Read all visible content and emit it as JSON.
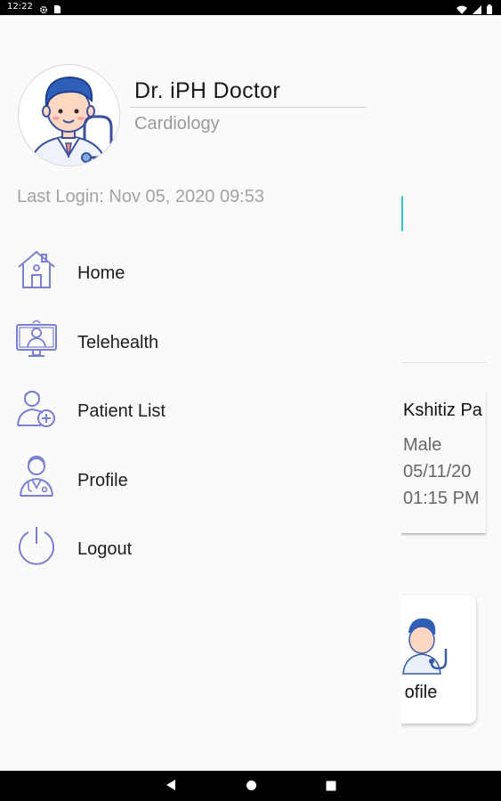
{
  "status_bar": {
    "time": "12:22",
    "left_icons": [
      "gear-icon",
      "sim-card-icon"
    ],
    "right_icons": [
      "wifi-icon",
      "signal-icon",
      "battery-icon"
    ]
  },
  "drawer": {
    "doctor_name": "Dr. iPH Doctor",
    "specialty": "Cardiology",
    "last_login": "Last Login: Nov 05, 2020 09:53",
    "menu": [
      {
        "label": "Home",
        "icon": "home-icon"
      },
      {
        "label": "Telehealth",
        "icon": "telehealth-icon"
      },
      {
        "label": "Patient List",
        "icon": "patient-list-icon"
      },
      {
        "label": "Profile",
        "icon": "doctor-profile-icon"
      },
      {
        "label": "Logout",
        "icon": "power-icon"
      }
    ]
  },
  "background": {
    "patient_name": "Kshitiz Pa",
    "patient_gender": "Male",
    "patient_date": "05/11/20",
    "patient_time": "01:15 PM",
    "tile_label": "ofile"
  },
  "nav_bar": {
    "buttons": [
      "back-icon",
      "home-circle-icon",
      "recents-icon"
    ]
  },
  "colors": {
    "icon_stroke": "#7a7fd1",
    "accent": "#35c4cc",
    "avatar_hair": "#2e5fb8",
    "avatar_skin": "#ffd7c2"
  }
}
